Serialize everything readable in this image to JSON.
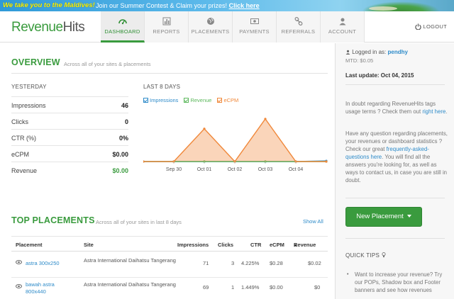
{
  "banner": {
    "headline": "We take you to the Maldives!",
    "text": "Join our Summer Contest & Claim your prizes!",
    "link": "Click here"
  },
  "header": {
    "logo_part1": "Revenue",
    "logo_part2": "Hits",
    "tabs": [
      {
        "label": "DASHBOARD",
        "icon": "dashboard-icon",
        "active": true
      },
      {
        "label": "REPORTS",
        "icon": "bar-chart-icon",
        "active": false
      },
      {
        "label": "PLACEMENTS",
        "icon": "globe-icon",
        "active": false
      },
      {
        "label": "PAYMENTS",
        "icon": "money-icon",
        "active": false
      },
      {
        "label": "REFERRALS",
        "icon": "link-icon",
        "active": false
      },
      {
        "label": "ACCOUNT",
        "icon": "user-icon",
        "active": false
      }
    ],
    "logout": "LOGOUT"
  },
  "overview": {
    "title": "OVERVIEW",
    "subtitle": "Across all of your sites & placements",
    "yesterday_title": "YESTERDAY",
    "stats": [
      {
        "label": "Impressions",
        "value": "46",
        "green": false
      },
      {
        "label": "Clicks",
        "value": "0",
        "green": false
      },
      {
        "label": "CTR (%)",
        "value": "0%",
        "green": false
      },
      {
        "label": "eCPM",
        "value": "$0.00",
        "green": false
      },
      {
        "label": "Revenue",
        "value": "$0.00",
        "green": true
      }
    ],
    "chart_title": "LAST 8 DAYS",
    "legend": [
      {
        "label": "Impressions",
        "color": "#2e8bc9"
      },
      {
        "label": "Revenue",
        "color": "#5cb85c"
      },
      {
        "label": "eCPM",
        "color": "#f0883a"
      }
    ]
  },
  "chart_data": {
    "type": "area",
    "categories": [
      "",
      "Sep 30",
      "Oct 01",
      "Oct 02",
      "Oct 03",
      "Oct 04",
      ""
    ],
    "series": [
      {
        "name": "Impressions",
        "color": "#2e8bc9",
        "values": [
          0,
          0,
          0,
          0,
          0,
          0,
          0.02
        ]
      },
      {
        "name": "Revenue",
        "color": "#5cb85c",
        "values": [
          0,
          0,
          0,
          0,
          0,
          0,
          0
        ]
      },
      {
        "name": "eCPM",
        "color": "#f0883a",
        "values": [
          0,
          0,
          1,
          0,
          1.3,
          0,
          0
        ]
      }
    ],
    "ylim": [
      0,
      1.6
    ],
    "grid": false
  },
  "placements": {
    "title": "TOP PLACEMENTS",
    "subtitle": "Across all of your sites in last 8 days",
    "show_all": "Show All",
    "columns": [
      "Placement",
      "Site",
      "Impressions",
      "Clicks",
      "CTR",
      "eCPM",
      "Revenue"
    ],
    "rows": [
      {
        "placement": "astra 300x250",
        "site": "Astra International Daihatsu Tangerang",
        "impressions": "71",
        "clicks": "3",
        "ctr": "4.225%",
        "ecpm": "$0.28",
        "revenue": "$0.02"
      },
      {
        "placement": "bawah astra 800x440",
        "site": "Astra International Daihatsu Tangerang",
        "impressions": "69",
        "clicks": "1",
        "ctr": "1.449%",
        "ecpm": "$0.00",
        "revenue": "$0"
      }
    ]
  },
  "sidebar": {
    "logged_label": "Logged in as:",
    "username": "pendhy",
    "mtd": "MTD: $0.05",
    "last_update": "Last update: Oct 04, 2015",
    "p1_before": "In doubt regarding RevenueHits tags usage terms ? Check them out ",
    "p1_link": "right here",
    "p1_after": ".",
    "p2_before": "Have any question regarding placements, your revenues or dashboard statistics ? Check our great ",
    "p2_link": "frequently-asked-questions here",
    "p2_after": ". You will find all the answers you're looking for, as well as ways to contact us, in case you are still in doubt.",
    "new_placement": "New Placement",
    "quick_tips": "QUICK TIPS",
    "tip1": "Want to increase your revenue? Try our POPs, Shadow box and Footer banners and see how revenues"
  }
}
